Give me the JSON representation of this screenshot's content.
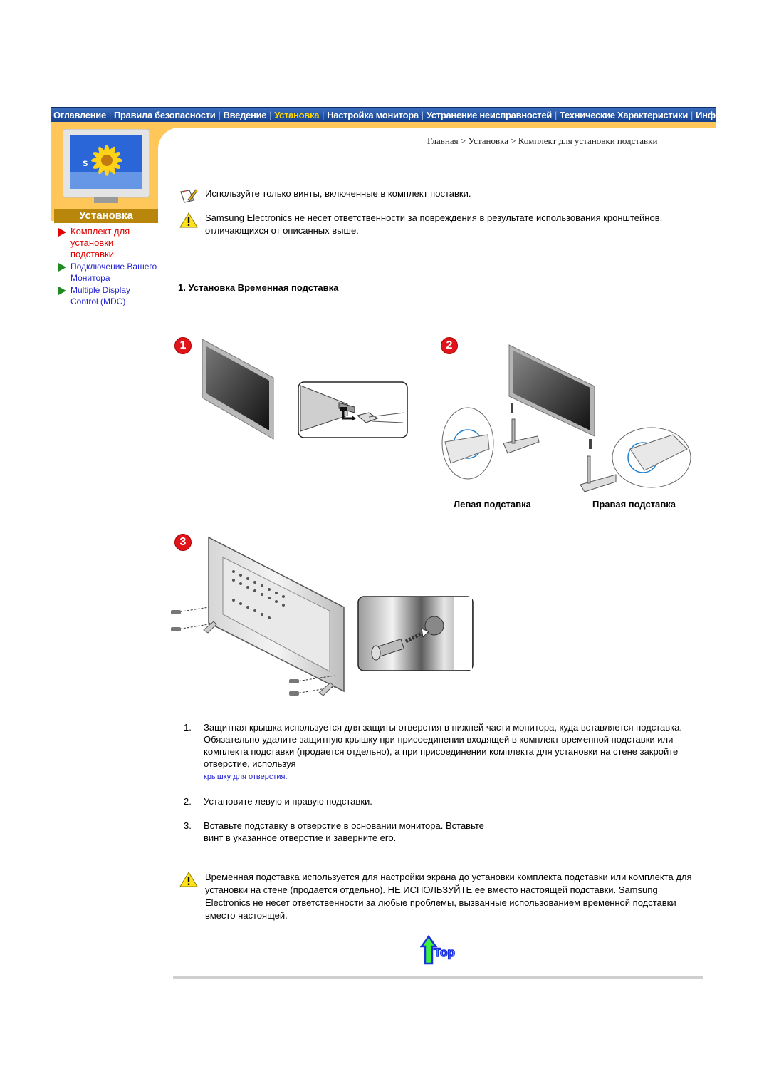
{
  "topnav": {
    "items": [
      {
        "label": "Оглавление",
        "active": false
      },
      {
        "label": "Правила безопасности",
        "active": false
      },
      {
        "label": "Введение",
        "active": false
      },
      {
        "label": "Установка",
        "active": true
      },
      {
        "label": "Настройка монитора",
        "active": false
      },
      {
        "label": "Устранение неисправностей",
        "active": false
      },
      {
        "label": "Технические Характеристики",
        "active": false
      },
      {
        "label": "Информаци",
        "active": false
      }
    ]
  },
  "sidebar": {
    "section_title": "Установка",
    "items": [
      {
        "label": "Комплект для установки подставки",
        "current": true
      },
      {
        "label": "Подключение Вашего Монитора",
        "current": false
      },
      {
        "label": "Multiple Display Control (MDC)",
        "current": false
      }
    ]
  },
  "breadcrumb": "Главная > Установка > Комплект для установки подставки",
  "notes": {
    "note1": "Используйте только винты, включенные в комплект поставки.",
    "note2": "Samsung Electronics не несет ответственности за повреждения в результате использования кронштейнов, отличающихся от описанных выше.",
    "note3": "Временная подставка используется для настройки экрана до установки комплекта подставки или комплекта для установки на стене (продается отдельно). НЕ ИСПОЛЬЗУЙТЕ ее вместо настоящей подставки. Samsung Electronics не несет ответственности за любые проблемы, вызванные использованием временной подставки вместо настоящей."
  },
  "section_heading": "1. Установка Временная подставка",
  "figures": {
    "step1_badge": "1",
    "step2_badge": "2",
    "step3_badge": "3",
    "left_stand_label": "Левая подставка",
    "right_stand_label": "Правая подставка"
  },
  "steps": [
    {
      "num": "1.",
      "text": "Защитная крышка используется для защиты отверстия в нижней части монитора, куда вставляется подставка. Обязательно удалите защитную крышку при присоединении входящей в комплект временной подставки или комплекта подставки (продается отдельно), а при присоединении комплекта для установки на стене закройте отверстие, используя",
      "link": "крышку для отверстия."
    },
    {
      "num": "2.",
      "text": "Установите левую и правую подставки."
    },
    {
      "num": "3.",
      "text": "Вставьте подставку в отверстие в основании монитора. Вставьте винт в указанное отверстие и заверните его."
    }
  ],
  "top_button": "Top",
  "colors": {
    "nav_blue": "#1f4fa0",
    "nav_active": "#ffd800",
    "orange": "#ffc65a",
    "section_gold": "#b8860b",
    "current_red": "#e00000",
    "link_blue": "#2424d0"
  }
}
